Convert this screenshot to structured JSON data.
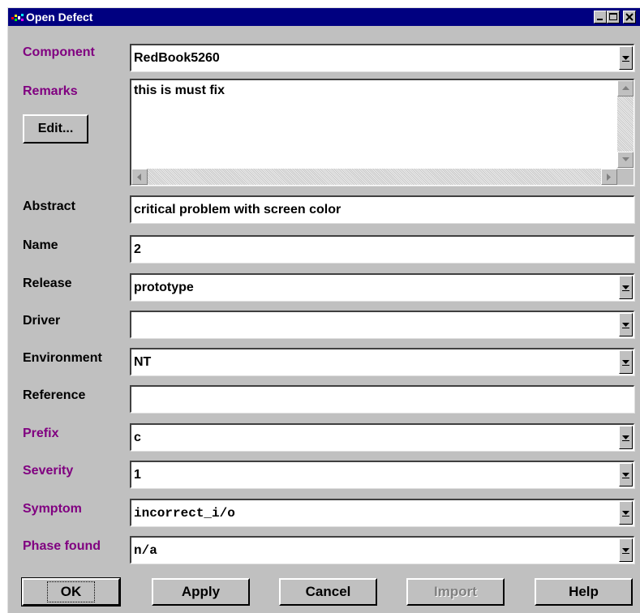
{
  "window": {
    "title": "Open Defect"
  },
  "fields": {
    "component": {
      "label": "Component",
      "value": "RedBook5260"
    },
    "remarks": {
      "label": "Remarks",
      "value": "this is must fix",
      "edit_button": "Edit..."
    },
    "abstract": {
      "label": "Abstract",
      "value": "critical problem with screen color"
    },
    "name": {
      "label": "Name",
      "value": "2"
    },
    "release": {
      "label": "Release",
      "value": "prototype"
    },
    "driver": {
      "label": "Driver",
      "value": ""
    },
    "environment": {
      "label": "Environment",
      "value": "NT"
    },
    "reference": {
      "label": "Reference",
      "value": ""
    },
    "prefix": {
      "label": "Prefix",
      "value": "c"
    },
    "severity": {
      "label": "Severity",
      "value": "1"
    },
    "symptom": {
      "label": "Symptom",
      "value": "incorrect_i/o"
    },
    "phase_found": {
      "label": "Phase found",
      "value": "n/a"
    }
  },
  "buttons": {
    "ok": "OK",
    "apply": "Apply",
    "cancel": "Cancel",
    "import": "Import",
    "help": "Help"
  },
  "colors": {
    "titlebar": "#000080",
    "required_label": "#800080",
    "dialog_face": "#c0c0c0"
  },
  "icons": {
    "app": "app-icon",
    "minimize": "minimize-icon",
    "maximize": "maximize-icon",
    "close": "close-icon",
    "dropdown": "chevron-down-icon"
  }
}
